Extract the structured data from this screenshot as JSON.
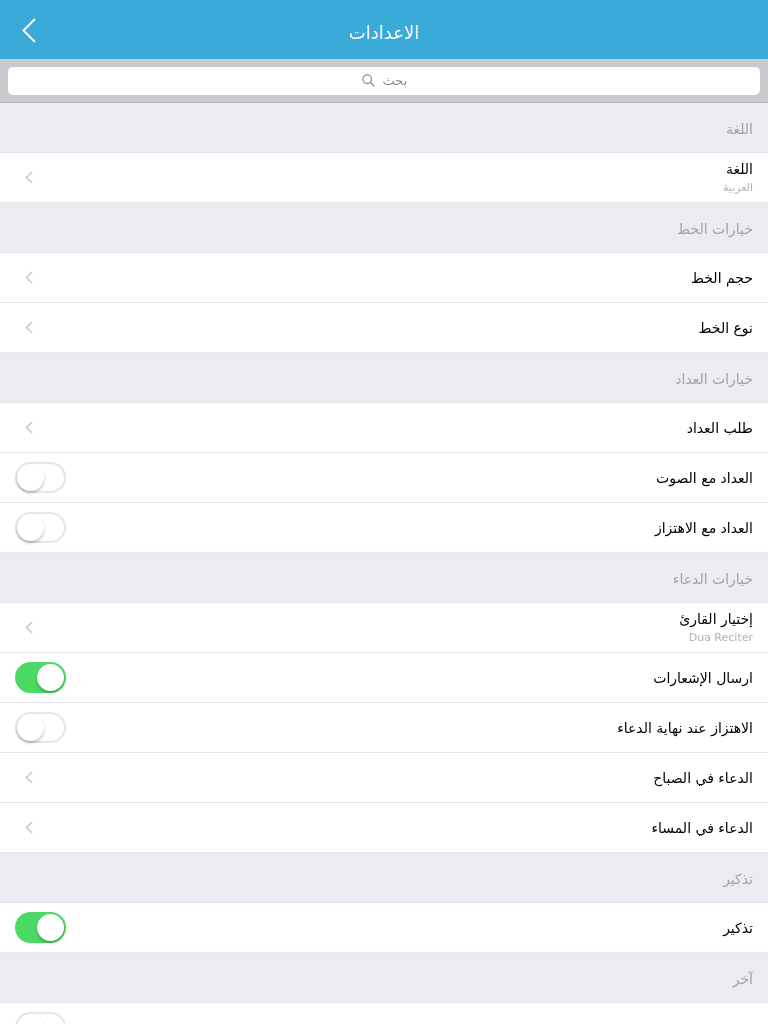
{
  "nav_bar": {
    "title": "الاعدادات"
  },
  "search": {
    "placeholder": "بحث"
  },
  "sections": [
    {
      "header": "اللغة",
      "rows": [
        {
          "kind": "link",
          "label": "اللغة",
          "subtitle": "العربية"
        }
      ]
    },
    {
      "header": "خيارات الخط",
      "rows": [
        {
          "kind": "link",
          "label": "حجم الخط"
        },
        {
          "kind": "link",
          "label": "نوع الخط"
        }
      ]
    },
    {
      "header": "خيارات العداد",
      "rows": [
        {
          "kind": "link",
          "label": "طلب العداد"
        },
        {
          "kind": "toggle",
          "label": "العداد مع الصوت",
          "on": false
        },
        {
          "kind": "toggle",
          "label": "العداد مع الاهتزاز",
          "on": false
        }
      ]
    },
    {
      "header": "خيارات الدعاء",
      "rows": [
        {
          "kind": "link",
          "label": "إختيار القارئ",
          "subtitle": "Dua Reciter"
        },
        {
          "kind": "toggle",
          "label": "ارسال الإشعارات",
          "on": true
        },
        {
          "kind": "toggle",
          "label": "الاهتزاز عند نهاية الدعاء",
          "on": false
        },
        {
          "kind": "link",
          "label": "الدعاء في الصباح"
        },
        {
          "kind": "link",
          "label": "الدعاء في المساء"
        }
      ]
    },
    {
      "header": "تذكير",
      "rows": [
        {
          "kind": "toggle",
          "label": "تذكير",
          "on": true
        }
      ]
    },
    {
      "header": "آخر",
      "rows": [
        {
          "kind": "toggle",
          "on": false
        }
      ]
    }
  ]
}
